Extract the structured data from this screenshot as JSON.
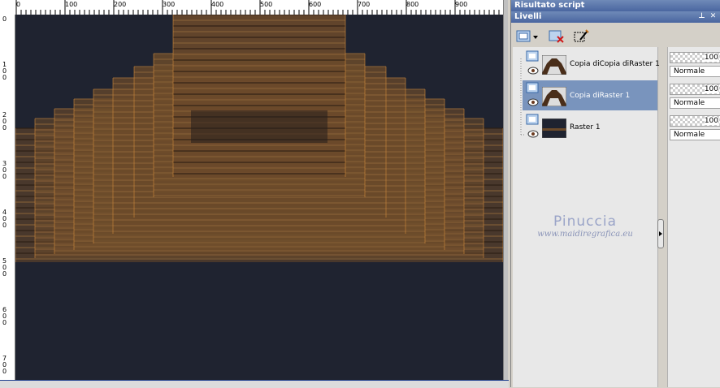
{
  "ruler": {
    "top_ticks": [
      "0",
      "100",
      "200",
      "300",
      "400",
      "500",
      "600",
      "700",
      "800",
      "900"
    ],
    "left_ticks": [
      "0",
      "100",
      "200",
      "300",
      "400",
      "500",
      "600",
      "700"
    ]
  },
  "panels": {
    "script_output_title": "Risultato script",
    "layers_title": "Livelli"
  },
  "layers": [
    {
      "name": "Copia diCopia diRaster 1",
      "opacity": "100",
      "blend": "Normale",
      "selected": false
    },
    {
      "name": "Copia diRaster 1",
      "opacity": "100",
      "blend": "Normale",
      "selected": true
    },
    {
      "name": "Raster 1",
      "opacity": "100",
      "blend": "Normale",
      "selected": false
    }
  ],
  "watermark": {
    "name": "Pinuccia",
    "url": "www.maidiregrafica.eu"
  },
  "colors": {
    "canvas_bg": "#1f2330",
    "accent_selection": "#7994bd",
    "brown": "#6b4a2a",
    "orange_edge": "#d08a3a"
  }
}
